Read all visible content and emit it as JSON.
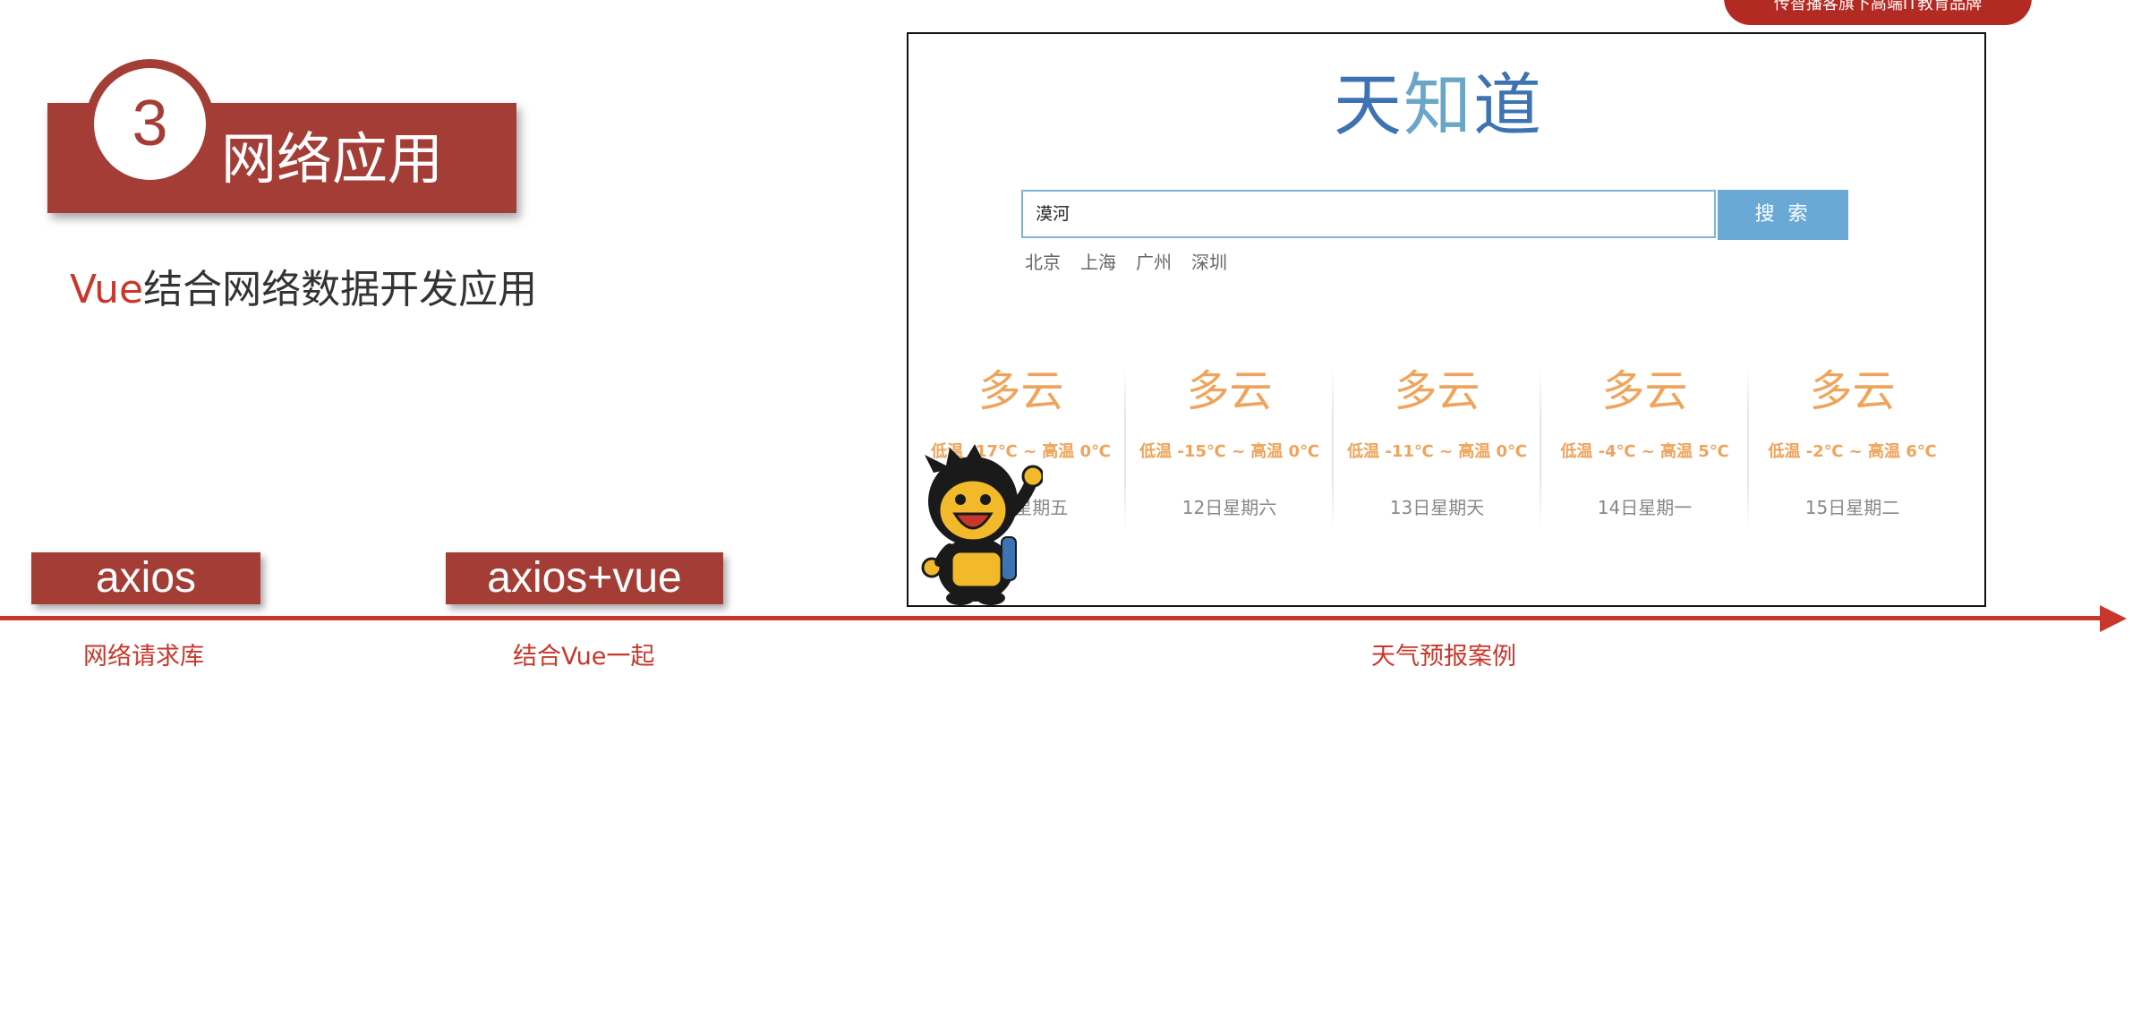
{
  "brand_pill": {
    "text": "传智播客旗下高端IT教育品牌"
  },
  "section": {
    "number": "3",
    "title": "网络应用"
  },
  "subtitle": {
    "highlight": "Vue",
    "rest": "结合网络数据开发应用"
  },
  "tags": {
    "axios": "axios",
    "axios_vue": "axios+vue"
  },
  "timeline": {
    "label1": "网络请求库",
    "label2": "结合Vue一起",
    "label3": "天气预报案例"
  },
  "app": {
    "logo": [
      "天",
      "知",
      "道"
    ],
    "search_value": "漠河",
    "search_button": "搜 索",
    "hot_cities": [
      "北京",
      "上海",
      "广州",
      "深圳"
    ],
    "forecast": [
      {
        "cond": "多云",
        "temp": "低温 -17℃ ~ 高温 0℃",
        "date": "11日星期五"
      },
      {
        "cond": "多云",
        "temp": "低温 -15℃ ~ 高温 0℃",
        "date": "12日星期六"
      },
      {
        "cond": "多云",
        "temp": "低温 -11℃ ~ 高温 0℃",
        "date": "13日星期天"
      },
      {
        "cond": "多云",
        "temp": "低温 -4℃ ~ 高温 5℃",
        "date": "14日星期一"
      },
      {
        "cond": "多云",
        "temp": "低温 -2℃ ~ 高温 6℃",
        "date": "15日星期二"
      }
    ]
  },
  "colors": {
    "accent": "#a43d36",
    "timeline": "#c9372c",
    "weather": "#f0a35a",
    "button": "#6aa9d6"
  }
}
